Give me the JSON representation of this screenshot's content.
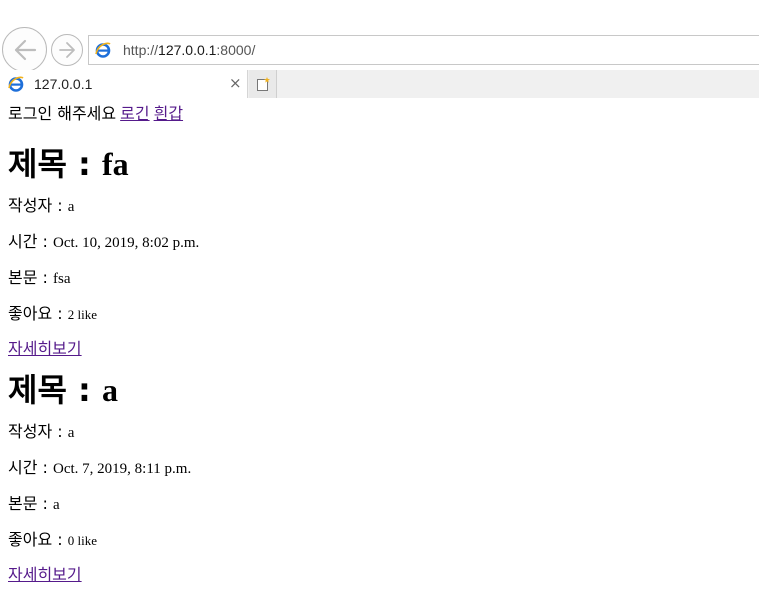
{
  "browser": {
    "url_prefix": "http://",
    "url_host": "127.0.0.1",
    "url_suffix": ":8000/",
    "tab_title": "127.0.0.1",
    "tab_close": "×"
  },
  "page": {
    "login_prompt": "로그인 해주세요",
    "login_link": "로긴",
    "signup_link": "흰갑",
    "posts": [
      {
        "title_label": "제목 : ",
        "title": "fa",
        "author_label": "작성자 : ",
        "author": "a",
        "time_label": "시간 : ",
        "time": "Oct. 10, 2019, 8:02 p.m.",
        "body_label": "본문 : ",
        "body": "fsa",
        "likes_label": "좋아요 : ",
        "likes": "2 like",
        "detail_link": "자세히보기"
      },
      {
        "title_label": "제목 : ",
        "title": "a",
        "author_label": "작성자 : ",
        "author": "a",
        "time_label": "시간 : ",
        "time": "Oct. 7, 2019, 8:11 p.m.",
        "body_label": "본문 : ",
        "body": "a",
        "likes_label": "좋아요 : ",
        "likes": "0 like",
        "detail_link": "자세히보기"
      }
    ]
  },
  "colors": {
    "link_visited": "#551a8b",
    "ie_blue": "#1e6fd9",
    "ie_gold": "#f2b21b"
  },
  "icons": {
    "back": "back-arrow-icon",
    "forward": "forward-arrow-icon",
    "ie": "internet-explorer-icon",
    "new_tab": "new-tab-icon"
  }
}
